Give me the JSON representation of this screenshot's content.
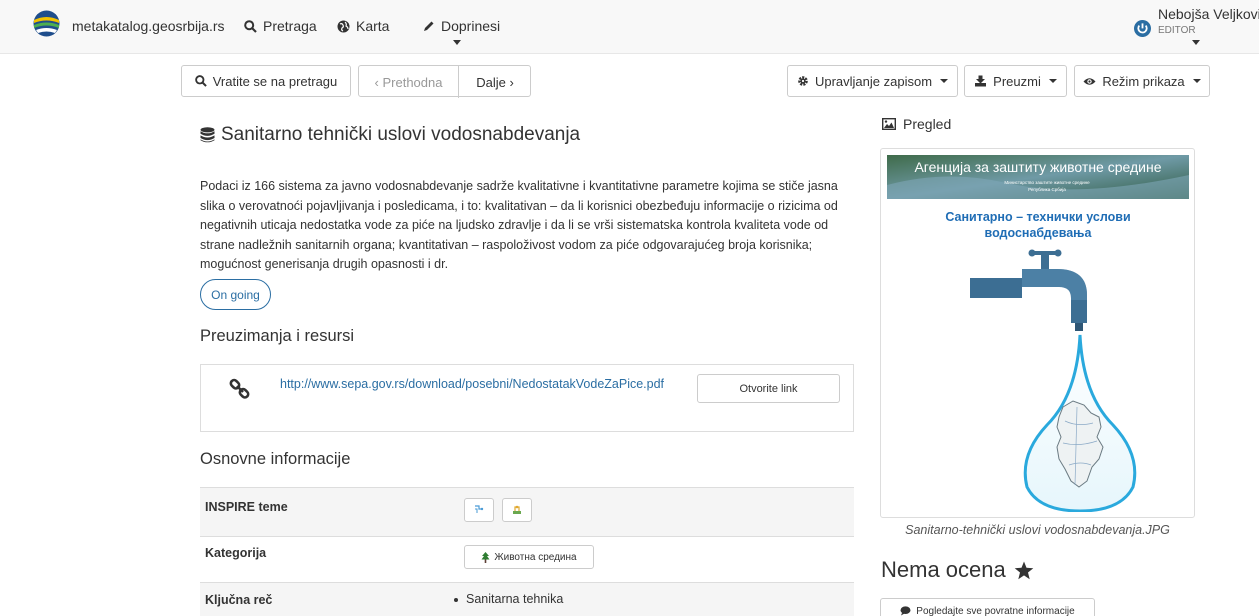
{
  "navbar": {
    "brand": "metakatalog.geosrbija.rs",
    "items": [
      {
        "label": "Pretraga",
        "icon": "search-icon"
      },
      {
        "label": "Karta",
        "icon": "globe-icon"
      },
      {
        "label": "Doprinesi",
        "icon": "pencil-icon"
      }
    ],
    "user": {
      "name": "Nebojša Veljković",
      "role": "EDITOR"
    }
  },
  "toolbar": {
    "back": "Vratite se na pretragu",
    "prev": "‹  Prethodna",
    "next": "Dalje  ›",
    "manage": "Upravljanje zapisom",
    "download": "Preuzmi",
    "view_mode": "Režim prikaza"
  },
  "record": {
    "title": "Sanitarno tehnički uslovi vodosnabdevanja",
    "description": "Podaci iz 166 sistema za javno vodosnabdevanje sadrže kvalitativne i kvantitativne parametre kojima se stiče jasna slika o verovatnoći pojavljivanja i posledicama, i to: kvalitativan – da li korisnici obezbeđuju informacije o rizicima od negativnih uticaja nedostatka vode za piće na ljudsko zdravlje i da li se vrši sistematska kontrola kvaliteta vode od strane nadležnih sanitarnih organa; kvantitativan – raspoloživost vodom za piće odgovarajućeg broja korisnika; mogućnost generisanja drugih opasnosti i dr.",
    "status": "On going"
  },
  "resources": {
    "heading": "Preuzimanja i resursi",
    "items": [
      {
        "url": "http://www.sepa.gov.rs/download/posebni/NedostatakVodeZaPice.pdf",
        "button": "Otvorite link"
      }
    ]
  },
  "basic_info": {
    "heading": "Osnovne informacije",
    "rows": [
      {
        "label": "INSPIRE teme"
      },
      {
        "label": "Kategorija",
        "value": "Животна средина"
      },
      {
        "label": "Ključna reč",
        "values": [
          "Sanitarna tehnika"
        ]
      }
    ]
  },
  "sidebar": {
    "preview_title": "Pregled",
    "preview_image": {
      "banner_text": "Агенција за заштиту животне средине",
      "banner_sub1": "Министарство заштите животне средине",
      "banner_sub2": "Република Србија",
      "poster_title_line1": "Санитарно – технички услови",
      "poster_title_line2": "водоснабдевања"
    },
    "preview_caption": "Sanitarno-tehnički uslovi vodosnabdevanja.JPG",
    "rating": "Nema ocena",
    "feedback_button": "Pogledajte sve povratne informacije"
  },
  "colors": {
    "link": "#2b6ea3",
    "navbar_bg": "#f8f8f8",
    "poster_title": "#1f6db5",
    "faucet": "#3c6e93",
    "water_outline": "#2aa9dd"
  }
}
